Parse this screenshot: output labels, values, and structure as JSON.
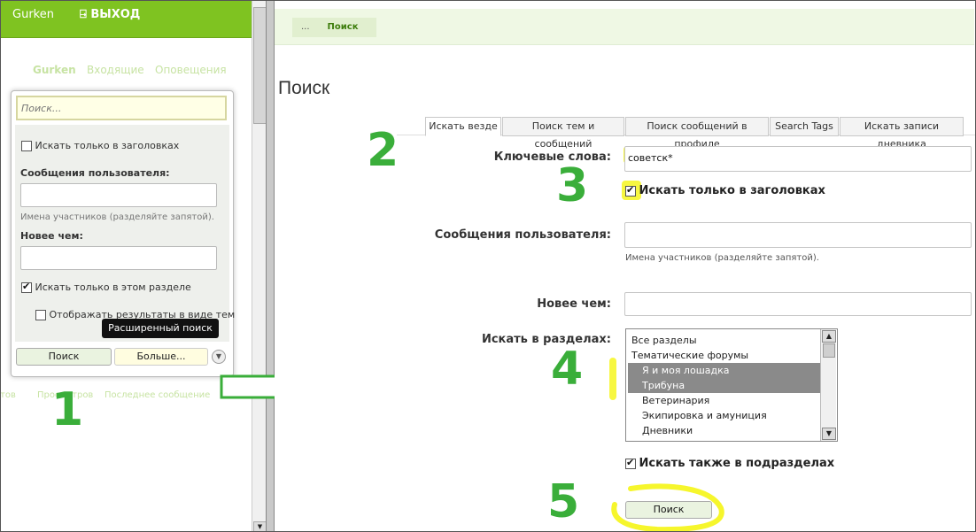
{
  "left": {
    "user": "Gurken",
    "logout": "ВЫХОД",
    "nav": [
      "Gurken",
      "Входящие",
      "Оповещения"
    ],
    "popup": {
      "search_placeholder": "Поиск...",
      "titles_only": "Искать только в заголовках",
      "user_messages_label": "Сообщения пользователя:",
      "user_hint": "Имена участников (разделяйте запятой).",
      "newer_label": "Новее чем:",
      "this_section_only": "Искать только в этом разделе",
      "show_as_threads": "Отображать результаты в виде тем",
      "search_button": "Поиск",
      "more_button": "Больше..."
    },
    "tooltip": "Расширенный поиск",
    "footer": [
      "тов",
      "Просмотров",
      "Последнее сообщение"
    ]
  },
  "right": {
    "breadcrumbs": [
      "...",
      "Поиск"
    ],
    "page_title": "Поиск",
    "tabs": [
      "Искать везде",
      "Поиск тем и сообщений",
      "Поиск сообщений в профиле",
      "Search Tags",
      "Искать записи дневника"
    ],
    "keywords_label": "Ключевые слова:",
    "keywords_value": "советск*",
    "titles_only": "Искать только в заголовках",
    "user_messages_label": "Сообщения пользователя:",
    "user_hint": "Имена участников (разделяйте запятой).",
    "newer_label": "Новее чем:",
    "sections_label": "Искать в разделах:",
    "sections": [
      {
        "label": "Все разделы",
        "selected": false,
        "indent": false
      },
      {
        "label": "Тематические форумы",
        "selected": false,
        "indent": false
      },
      {
        "label": "Я и моя лошадка",
        "selected": true,
        "indent": true
      },
      {
        "label": "Трибуна",
        "selected": true,
        "indent": true
      },
      {
        "label": "Ветеринария",
        "selected": false,
        "indent": true
      },
      {
        "label": "Экипировка и амуниция",
        "selected": false,
        "indent": true
      },
      {
        "label": "Дневники",
        "selected": false,
        "indent": true
      }
    ],
    "include_subsections": "Искать также в подразделах",
    "search_button": "Поиск"
  },
  "annotations": [
    "1",
    "2",
    "3",
    "4",
    "5"
  ],
  "colors": {
    "brand_green": "#7fc321",
    "annotation_green": "#3aae3a",
    "highlight_yellow": "#f6f62c"
  }
}
